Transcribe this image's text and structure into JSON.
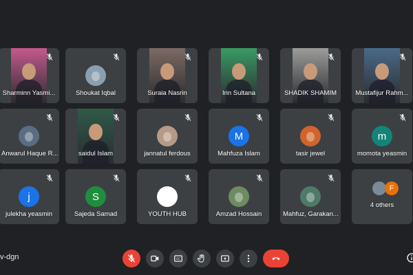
{
  "participants": [
    {
      "name": "Sharminn Yasmi...",
      "type": "video",
      "bg": "#c45a8e"
    },
    {
      "name": "Shoukat Iqbal",
      "type": "avatar-photo",
      "bg": "#8aa0b0"
    },
    {
      "name": "Suraia Nasrin",
      "type": "video",
      "bg": "#7d6a64"
    },
    {
      "name": "Irin Sultana",
      "type": "video",
      "bg": "#3a9b63"
    },
    {
      "name": "SHADIK SHAMIM",
      "type": "video",
      "bg": "#9c9c9a"
    },
    {
      "name": "Mustafijur Rahm...",
      "type": "video",
      "bg": "#4a6a88"
    },
    {
      "name": "Anwarul Haque R...",
      "type": "avatar-photo",
      "bg": "#5b6d82"
    },
    {
      "name": "saidul Islam",
      "type": "video",
      "bg": "#2f5a48"
    },
    {
      "name": "jannatul ferdous",
      "type": "avatar-photo",
      "bg": "#b59a86"
    },
    {
      "name": "Mahfuza Islam",
      "type": "avatar",
      "letter": "M",
      "bg": "#1a73e8"
    },
    {
      "name": "tasir jewel",
      "type": "avatar-photo",
      "bg": "#d0642c"
    },
    {
      "name": "momota yeasmin",
      "type": "avatar",
      "letter": "m",
      "bg": "#12857a"
    },
    {
      "name": "julekha yeasmin",
      "type": "avatar",
      "letter": "j",
      "bg": "#1a73e8"
    },
    {
      "name": "Sajeda Samad",
      "type": "avatar",
      "letter": "S",
      "bg": "#1e8e3e"
    },
    {
      "name": "YOUTH HUB",
      "type": "avatar-photo",
      "bg": "#ffffff"
    },
    {
      "name": "Amzad Hossain",
      "type": "avatar-photo",
      "bg": "#6e8b62"
    },
    {
      "name": "Mahfuz, Garakan...",
      "type": "avatar-photo",
      "bg": "#4f7a68"
    }
  ],
  "others": {
    "label": "4 others",
    "letter": "F",
    "letter_bg": "#e8710a",
    "photo_bg": "#7a8a99"
  },
  "meeting_code": "v-dgn",
  "colors": {
    "tile": "#3c4043",
    "background": "#202124",
    "danger": "#ea4335"
  }
}
